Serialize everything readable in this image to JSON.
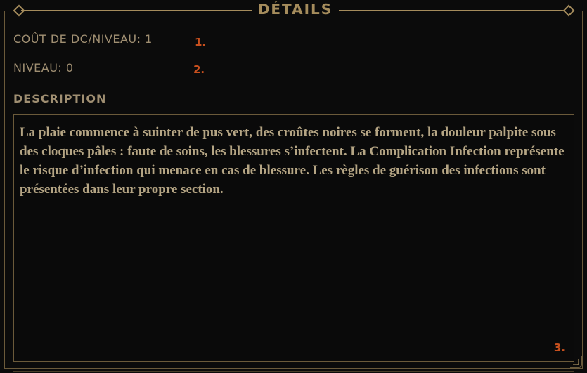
{
  "header": {
    "title": "DÉTAILS"
  },
  "fields": {
    "cost": {
      "label": "COÛT DE DC/NIVEAU:",
      "value": "1",
      "marker": "1."
    },
    "level": {
      "label": "NIVEAU:",
      "value": "0",
      "marker": "2."
    }
  },
  "description": {
    "label": "DESCRIPTION",
    "text": "La plaie commence à suinter de pus vert, des croûtes noires se forment, la douleur palpite sous des cloques pâles : faute de soins, les blessures s’infectent. La Complication Infection représente le risque d’infection qui menace en cas de blessure. Les règles de guérison des infections sont présentées dans leur propre section.",
    "marker": "3."
  },
  "colors": {
    "accent": "#a58c5c",
    "text": "#a08f72",
    "body_text": "#b5a584",
    "marker": "#c8501e",
    "background": "#0b0b0b"
  },
  "icons": {
    "header_ornaments": "diamond-icon",
    "resize": "resize-grip-icon"
  }
}
